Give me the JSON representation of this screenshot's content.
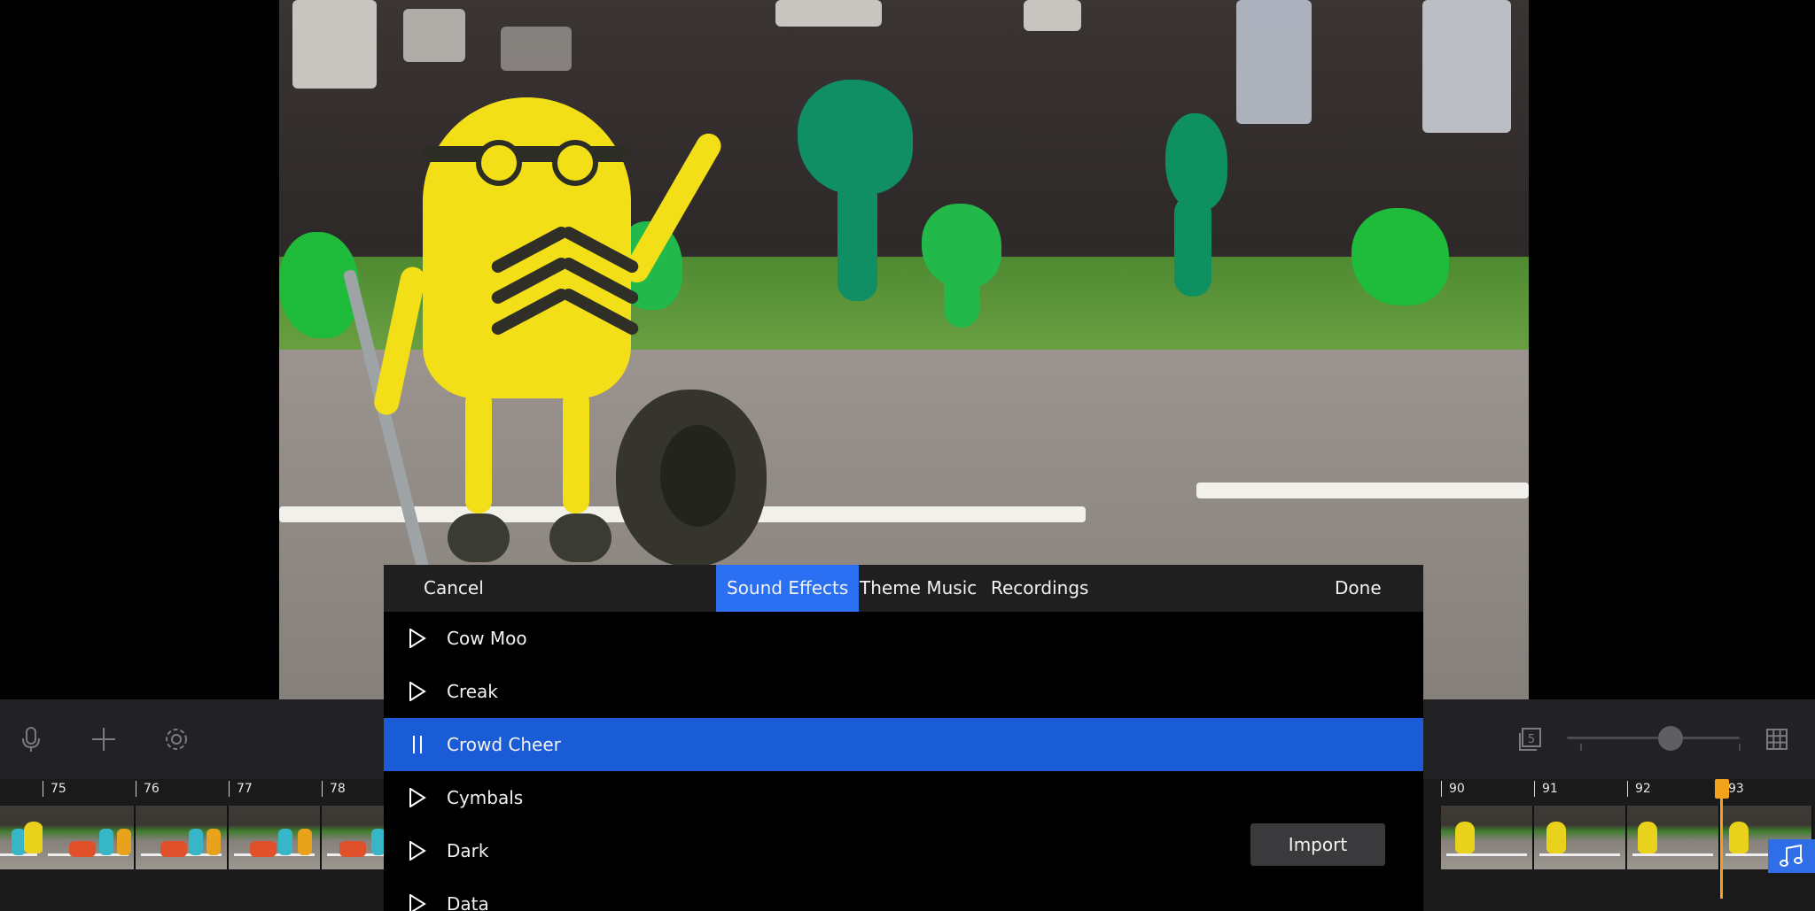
{
  "panel": {
    "header": {
      "cancel_label": "Cancel",
      "tabs": [
        {
          "label": "Sound Effects",
          "active": true
        },
        {
          "label": "Theme Music",
          "active": false
        },
        {
          "label": "Recordings",
          "active": false
        }
      ],
      "done_label": "Done"
    },
    "items": [
      {
        "label": "Cow Moo",
        "state": "play"
      },
      {
        "label": "Creak",
        "state": "play"
      },
      {
        "label": "Crowd Cheer",
        "state": "pause",
        "selected": true
      },
      {
        "label": "Cymbals",
        "state": "play"
      },
      {
        "label": "Dark",
        "state": "play"
      },
      {
        "label": "Data",
        "state": "play"
      }
    ],
    "import_label": "Import"
  },
  "toolbar": {
    "icons": [
      "microphone-icon",
      "add-icon",
      "gear-icon",
      "frame-count-icon",
      "grid-icon"
    ],
    "frame_count_badge": "5",
    "zoom_level": 0.6
  },
  "timeline": {
    "ruler_labels": [
      "75",
      "76",
      "77",
      "78",
      "90",
      "91",
      "92",
      "93"
    ],
    "music_icon": "music-note-icon"
  },
  "colors": {
    "accent": "#2b6ff3",
    "selected_row": "#1a5bd6",
    "playhead": "#f3a21c",
    "toolbar_bg": "#222224"
  }
}
